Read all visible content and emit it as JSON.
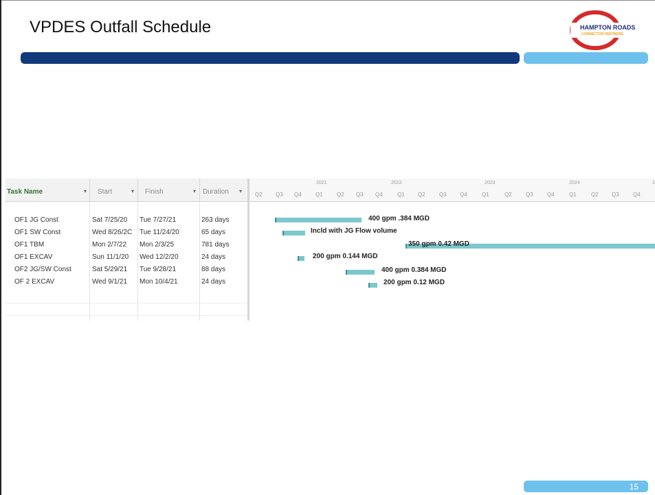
{
  "slide": {
    "title": "VPDES Outfall Schedule",
    "page_number": "15",
    "colors": {
      "dark_bar": "#123a7a",
      "light_bar": "#6ec1ec",
      "gantt_bar": "#7cc8cd"
    }
  },
  "logo": {
    "line1": "HAMPTON ROADS",
    "line2": "CONNECTOR PARTNERS"
  },
  "table": {
    "headers": {
      "task": "Task Name",
      "start": "Start",
      "finish": "Finish",
      "duration": "Duration"
    },
    "rows": [
      {
        "task": "OF1 JG Const",
        "start": "Sat 7/25/20",
        "finish": "Tue 7/27/21",
        "duration": "263 days"
      },
      {
        "task": "OF1 SW Const",
        "start": "Wed 8/26/2C",
        "finish": "Tue 11/24/20",
        "duration": "65 days"
      },
      {
        "task": "OF1 TBM",
        "start": "Mon 2/7/22",
        "finish": "Mon 2/3/25",
        "duration": "781 days"
      },
      {
        "task": "OF1 EXCAV",
        "start": "Sun 11/1/20",
        "finish": "Wed 12/2/20",
        "duration": "24 days"
      },
      {
        "task": "OF2 JG/SW Const",
        "start": "Sat 5/29/21",
        "finish": "Tue 9/28/21",
        "duration": "88 days"
      },
      {
        "task": "OF 2 EXCAV",
        "start": "Wed 9/1/21",
        "finish": "Mon 10/4/21",
        "duration": "24 days"
      }
    ]
  },
  "gantt": {
    "years": [
      "2021",
      "2022",
      "2023",
      "2024",
      "2"
    ],
    "quarters": [
      "Q2",
      "Q3",
      "Q4",
      "Q1",
      "Q2",
      "Q3",
      "Q4",
      "Q1",
      "Q2",
      "Q3",
      "Q4",
      "Q1",
      "Q2",
      "Q3",
      "Q4",
      "Q1",
      "Q2",
      "Q3",
      "Q4"
    ],
    "labels": [
      "400 gpm  .384 MGD",
      "Incld with JG Flow volume",
      "350 gpm  0.42 MGD",
      "200 gpm 0.144 MGD",
      "400 gpm  0.384 MGD",
      "200 gpm 0.12 MGD"
    ]
  }
}
